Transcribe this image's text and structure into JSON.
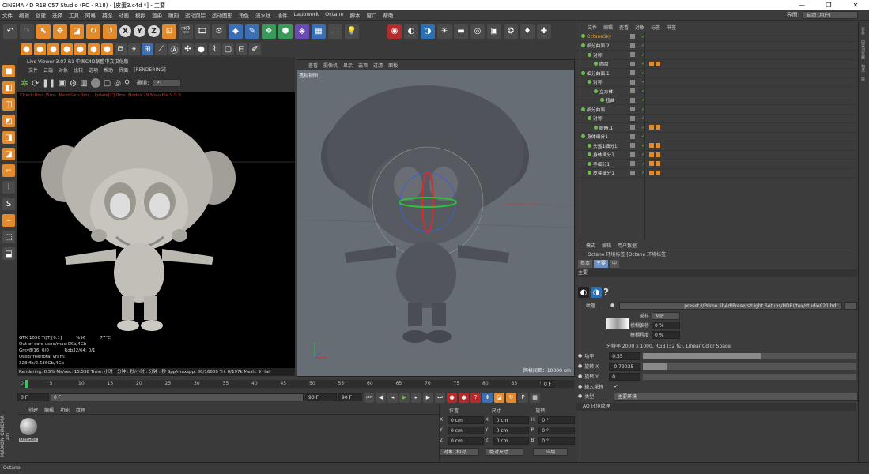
{
  "window": {
    "title": "CINEMA 4D R18.057 Studio (RC - R18) - [皮蛋3.c4d *] - 主要",
    "min": "—",
    "max": "❐",
    "close": "✕"
  },
  "menubar": {
    "items": [
      "文件",
      "编辑",
      "创建",
      "选择",
      "工具",
      "网格",
      "捕捉",
      "动画",
      "模拟",
      "渲染",
      "雕刻",
      "运动跟踪",
      "运动图形",
      "角色",
      "流水线",
      "插件",
      "Laubwerk",
      "Octane",
      "脚本",
      "窗口",
      "帮助"
    ],
    "layout_label": "界面:",
    "layout_value": "启动 (用户)"
  },
  "toolbar": {
    "letters": [
      "X",
      "Y",
      "Z"
    ]
  },
  "liveviewer": {
    "title": "Live Viewer 3.07-R1 中国C4D联盟中文汉化版",
    "menu": [
      "文件",
      "云端",
      "对象",
      "比较",
      "选项",
      "帮助",
      "界面",
      "[RENDERING]"
    ],
    "channel_label": "通道:",
    "channel_value": "PT",
    "status": "Check:0ms./5ms. MeshGen:0ms. Update[C]:0ms. Nodes:29 Movable:9  0 0",
    "stats": [
      [
        "GTX 1050 Ti[T][6.1]",
        "%96",
        "77°C"
      ],
      [
        "Out-of-core used/max:0Kb/4Gb",
        "",
        ""
      ],
      [
        "Grey8/16: 0/0",
        "Rgb32/64: 0/1",
        ""
      ],
      [
        "Used/free/total vram: 323Mb/2.636Gb/4Gb",
        "",
        ""
      ]
    ],
    "bottom": "Rendering: 0.5%    Ms/sec: 15.538   Time: 小时 : 分钟 : 秒/小时 : 分钟 : 秒   Spp/maxspp: 80/16000   Tri: 0/197k   Mesh: 9   Hair"
  },
  "viewport": {
    "menu": [
      "查看",
      "摄像机",
      "显示",
      "选项",
      "过滤",
      "面板"
    ],
    "label": "透视视图",
    "grid": "网格间距：10000 cm"
  },
  "timeline": {
    "ticks": [
      "0",
      "5",
      "10",
      "15",
      "20",
      "25",
      "30",
      "35",
      "40",
      "45",
      "50",
      "55",
      "60",
      "65",
      "70",
      "75",
      "80",
      "85",
      "90"
    ],
    "frame_end_marker": "0 F",
    "start": "0 F",
    "min": "0 F",
    "max": "90 F",
    "end": "90 F"
  },
  "material": {
    "menu": [
      "创建",
      "编辑",
      "功能",
      "纹理"
    ],
    "name": "OctGlos"
  },
  "coords": {
    "headers": [
      "位置",
      "尺寸",
      "旋转"
    ],
    "rows": [
      {
        "axis": "X",
        "pos": "0 cm",
        "size": "0 cm",
        "rot_axis": "H",
        "rot": "0 °"
      },
      {
        "axis": "Y",
        "pos": "0 cm",
        "size": "0 cm",
        "rot_axis": "P",
        "rot": "0 °"
      },
      {
        "axis": "Z",
        "pos": "0 cm",
        "size": "0 cm",
        "rot_axis": "B",
        "rot": "0 °"
      }
    ],
    "mode": "对象 (相对)",
    "size_mode": "绝对尺寸",
    "apply": "应用"
  },
  "objects": {
    "menu": [
      "文件",
      "编辑",
      "查看",
      "对象",
      "标签",
      "书签"
    ],
    "items": [
      {
        "name": "OctaneSky",
        "indent": 0,
        "tags": 0,
        "highlight": true
      },
      {
        "name": "细分曲面.2",
        "indent": 0,
        "tags": 0
      },
      {
        "name": "对称",
        "indent": 1,
        "tags": 0
      },
      {
        "name": "圆盘",
        "indent": 2,
        "tags": 2
      },
      {
        "name": "细分曲面.1",
        "indent": 0,
        "tags": 0
      },
      {
        "name": "对称",
        "indent": 1,
        "tags": 0
      },
      {
        "name": "立方体",
        "indent": 2,
        "tags": 0
      },
      {
        "name": "扭曲",
        "indent": 3,
        "tags": 0
      },
      {
        "name": "细分曲面",
        "indent": 0,
        "tags": 0
      },
      {
        "name": "对称",
        "indent": 1,
        "tags": 0
      },
      {
        "name": "眼睛.1",
        "indent": 2,
        "tags": 2
      },
      {
        "name": "身体细分1",
        "indent": 0,
        "tags": 0
      },
      {
        "name": "头盔1细分1",
        "indent": 1,
        "tags": 2
      },
      {
        "name": "身体细分1",
        "indent": 1,
        "tags": 2
      },
      {
        "name": "手细分1",
        "indent": 1,
        "tags": 2
      },
      {
        "name": "皮套细分1",
        "indent": 1,
        "tags": 2
      }
    ]
  },
  "attributes": {
    "menu": [
      "模式",
      "编辑",
      "用户数据"
    ],
    "title": "Octane 环境标签 [Octane 环境标签]",
    "tabs": [
      "基本",
      "主要",
      "中"
    ],
    "section": "主要",
    "texture_label": "纹理",
    "texture_path": "preset://Prime.lib4d/Presets/Light Setups/HDRI/tex/studio021.hdr",
    "sampling_label": "采样",
    "sampling_value": "MIP",
    "blur_offset_label": "模糊偏移",
    "blur_offset_value": "0 %",
    "blur_scale_label": "模糊程度",
    "blur_scale_value": "0 %",
    "resolution": "分辨率 2000 x 1000, RGB (32 位), Linear Color Space",
    "power_label": "功率",
    "power_value": "0.55",
    "power_fill": 0.55,
    "rotx_label": "旋转 X",
    "rotx_value": "-0.79035",
    "rotx_fill": 0.11,
    "roty_label": "旋转 Y",
    "roty_value": "0",
    "importance_label": "输入采样",
    "importance_check": "✔",
    "type_label": "类型",
    "type_value": "主要环境",
    "ao_label": "AO 环境纹理"
  },
  "sidebar": [
    "对象",
    "内容浏览器",
    "构造",
    "层"
  ],
  "status": "Octane:",
  "brand": "MAXON CINEMA 4D"
}
